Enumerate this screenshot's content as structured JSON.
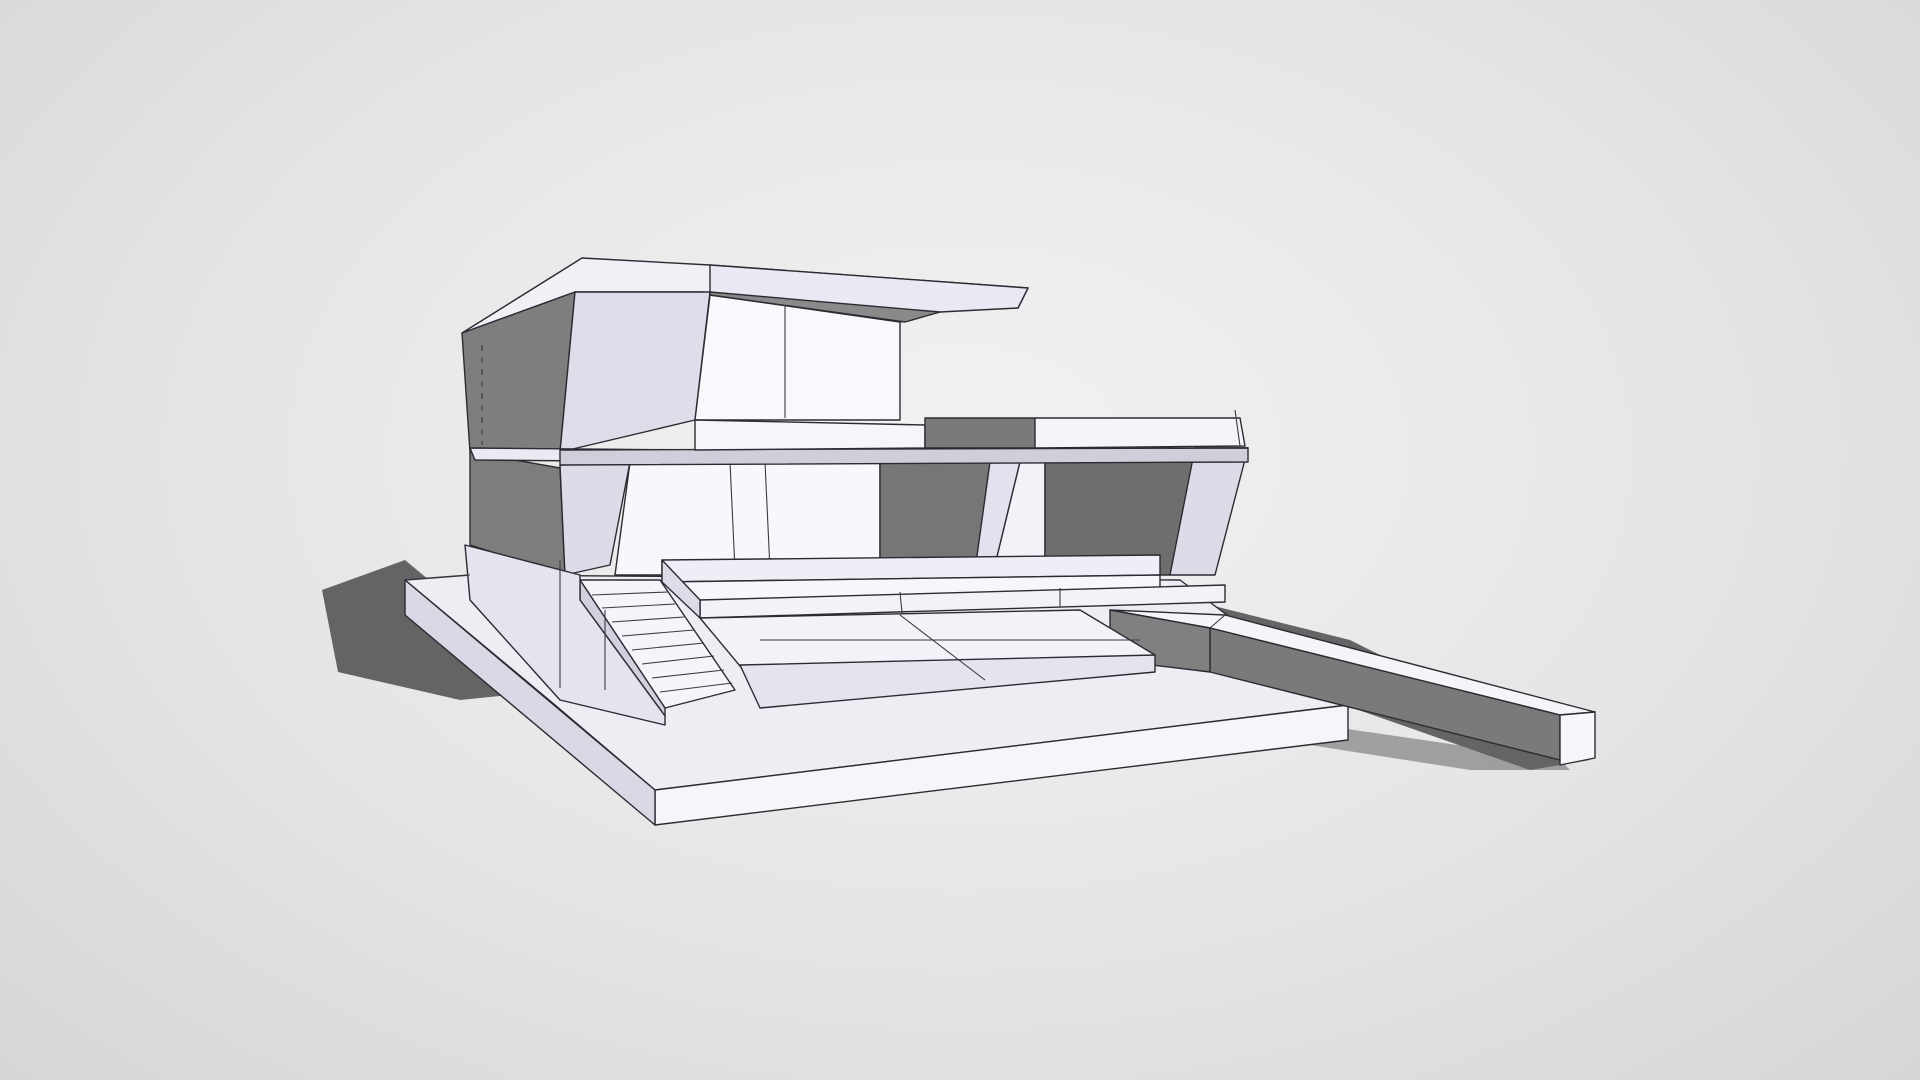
{
  "scene": {
    "type": "3d-model-viewport",
    "subject": "modern-house-white-model",
    "background_color": "#e6e6e6",
    "shadow_color": "#5a5a5a",
    "face_light": "#f7f7fb",
    "face_mid": "#e4e4ee",
    "face_dark": "#b7b7c8",
    "edge_color": "#2b2b33"
  }
}
